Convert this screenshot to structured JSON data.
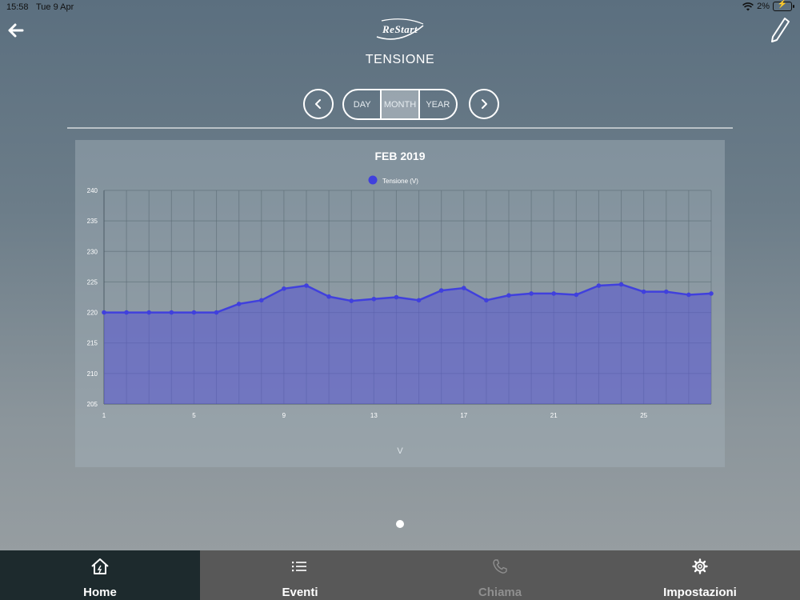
{
  "status_bar": {
    "time": "15:58",
    "date": "Tue 9 Apr",
    "battery": "2%"
  },
  "header": {
    "logo": "ReStart",
    "title": "TENSIONE",
    "back_icon": "arrow-left-icon",
    "edit_icon": "pencil-icon"
  },
  "period_selector": {
    "prev_icon": "chevron-left-icon",
    "next_icon": "chevron-right-icon",
    "options": [
      "DAY",
      "MONTH",
      "YEAR"
    ],
    "selected": "MONTH"
  },
  "colors": {
    "series": "#4040dd",
    "fill": "#5a5ad0",
    "active_tab": "#1d2a2d",
    "tabbar": "#585858"
  },
  "chart_data": {
    "type": "area",
    "title": "FEB 2019",
    "xlabel": "V",
    "ylabel": "",
    "legend": "top",
    "series": [
      {
        "name": "Tensione (V)",
        "x": [
          1,
          2,
          3,
          4,
          5,
          6,
          7,
          8,
          9,
          10,
          11,
          12,
          13,
          14,
          15,
          16,
          17,
          18,
          19,
          20,
          21,
          22,
          23,
          24,
          25,
          26,
          27,
          28
        ],
        "values": [
          220,
          220,
          220,
          220,
          220,
          220,
          221.4,
          222,
          223.9,
          224.4,
          222.6,
          221.9,
          222.2,
          222.5,
          222,
          223.6,
          224,
          222,
          222.8,
          223.1,
          223.1,
          222.9,
          224.4,
          224.6,
          223.4,
          223.4,
          222.9,
          223.1
        ]
      }
    ],
    "xticks": [
      "1",
      "5",
      "9",
      "13",
      "17",
      "21",
      "25"
    ],
    "yticks": [
      "205",
      "210",
      "215",
      "220",
      "225",
      "230",
      "235",
      "240"
    ],
    "ylim": [
      205,
      240
    ],
    "xlim": [
      1,
      28
    ],
    "grid": true
  },
  "tabbar": {
    "items": [
      {
        "label": "Home",
        "icon": "home-icon",
        "active": true
      },
      {
        "label": "Eventi",
        "icon": "list-icon",
        "active": false
      },
      {
        "label": "Chiama",
        "icon": "phone-icon",
        "active": false,
        "disabled": true
      },
      {
        "label": "Impostazioni",
        "icon": "gear-icon",
        "active": false
      }
    ]
  }
}
